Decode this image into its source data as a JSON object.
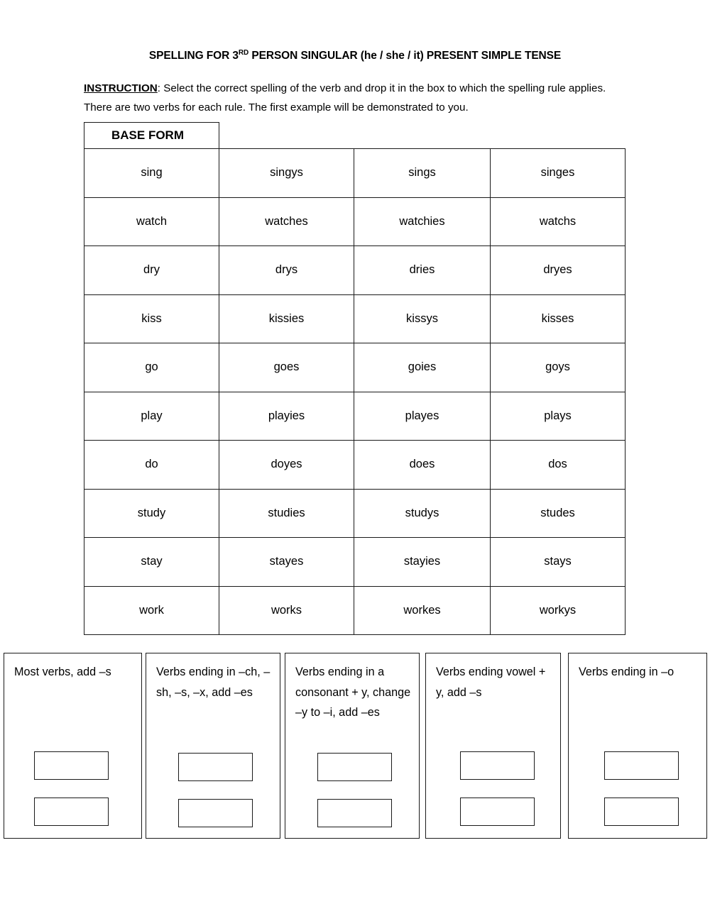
{
  "page": {
    "title_prefix": "SPELLING FOR 3",
    "title_superscript": "RD",
    "title_suffix": " PERSON SINGULAR (he / she / it) PRESENT SIMPLE TENSE",
    "instruction_label": "INSTRUCTION",
    "instruction_text": ":  Select the correct spelling of the verb and drop it in the box to which the spelling rule applies.  There are two verbs for each rule.  The first example will be demonstrated to you."
  },
  "table": {
    "header": "BASE FORM",
    "rows": [
      {
        "base": "sing",
        "o1": "singys",
        "o2": "sings",
        "o3": "singes"
      },
      {
        "base": "watch",
        "o1": "watches",
        "o2": "watchies",
        "o3": "watchs"
      },
      {
        "base": "dry",
        "o1": "drys",
        "o2": "dries",
        "o3": "dryes"
      },
      {
        "base": "kiss",
        "o1": "kissies",
        "o2": "kissys",
        "o3": "kisses"
      },
      {
        "base": "go",
        "o1": "goes",
        "o2": "goies",
        "o3": "goys"
      },
      {
        "base": "play",
        "o1": "playies",
        "o2": "playes",
        "o3": "plays"
      },
      {
        "base": "do",
        "o1": "doyes",
        "o2": "does",
        "o3": "dos"
      },
      {
        "base": "study",
        "o1": "studies",
        "o2": "studys",
        "o3": "studes"
      },
      {
        "base": "stay",
        "o1": "stayes",
        "o2": "stayies",
        "o3": "stays"
      },
      {
        "base": "work",
        "o1": "works",
        "o2": "workes",
        "o3": "workys"
      }
    ]
  },
  "rules": [
    {
      "text": "Most verbs, add –s"
    },
    {
      "text": "Verbs ending in –ch, –sh, –s, –x, add –es"
    },
    {
      "text": "Verbs ending in a consonant + y, change –y to –i, add –es"
    },
    {
      "text": "Verbs ending vowel + y, add –s"
    },
    {
      "text": "Verbs ending in –o"
    }
  ]
}
